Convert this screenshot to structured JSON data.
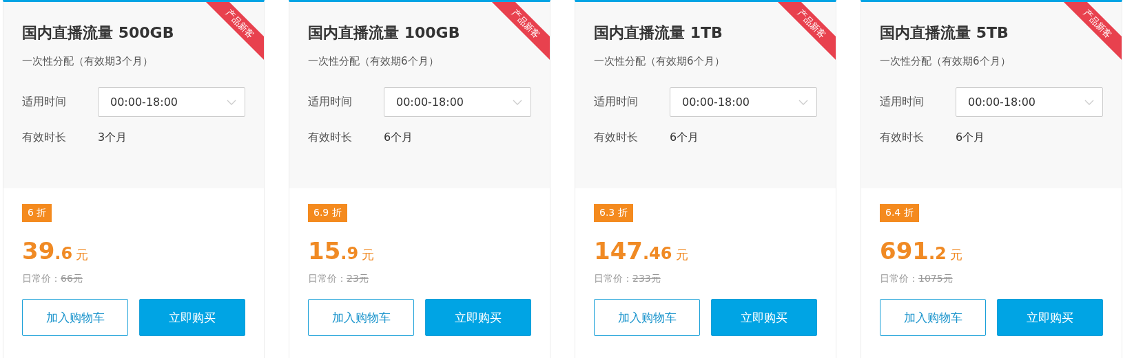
{
  "products": [
    {
      "ribbon": "产品新客",
      "title": "国内直播流量 500GB",
      "subtitle": "一次性分配（有效期3个月）",
      "time_label": "适用时间",
      "time_value": "00:00-18:00",
      "duration_label": "有效时长",
      "duration_value": "3个月",
      "discount": "6 折",
      "price_integer": "39",
      "price_decimal": ".6",
      "price_unit": "元",
      "regular_label": "日常价：",
      "regular_price": "66元",
      "cart_button": "加入购物车",
      "buy_button": "立即购买"
    },
    {
      "ribbon": "产品新客",
      "title": "国内直播流量 100GB",
      "subtitle": "一次性分配（有效期6个月）",
      "time_label": "适用时间",
      "time_value": "00:00-18:00",
      "duration_label": "有效时长",
      "duration_value": "6个月",
      "discount": "6.9 折",
      "price_integer": "15",
      "price_decimal": ".9",
      "price_unit": "元",
      "regular_label": "日常价：",
      "regular_price": "23元",
      "cart_button": "加入购物车",
      "buy_button": "立即购买"
    },
    {
      "ribbon": "产品新客",
      "title": "国内直播流量 1TB",
      "subtitle": "一次性分配（有效期6个月）",
      "time_label": "适用时间",
      "time_value": "00:00-18:00",
      "duration_label": "有效时长",
      "duration_value": "6个月",
      "discount": "6.3 折",
      "price_integer": "147",
      "price_decimal": ".46",
      "price_unit": "元",
      "regular_label": "日常价：",
      "regular_price": "233元",
      "cart_button": "加入购物车",
      "buy_button": "立即购买"
    },
    {
      "ribbon": "产品新客",
      "title": "国内直播流量 5TB",
      "subtitle": "一次性分配（有效期6个月）",
      "time_label": "适用时间",
      "time_value": "00:00-18:00",
      "duration_label": "有效时长",
      "duration_value": "6个月",
      "discount": "6.4 折",
      "price_integer": "691",
      "price_decimal": ".2",
      "price_unit": "元",
      "regular_label": "日常价：",
      "regular_price": "1075元",
      "cart_button": "加入购物车",
      "buy_button": "立即购买"
    }
  ]
}
